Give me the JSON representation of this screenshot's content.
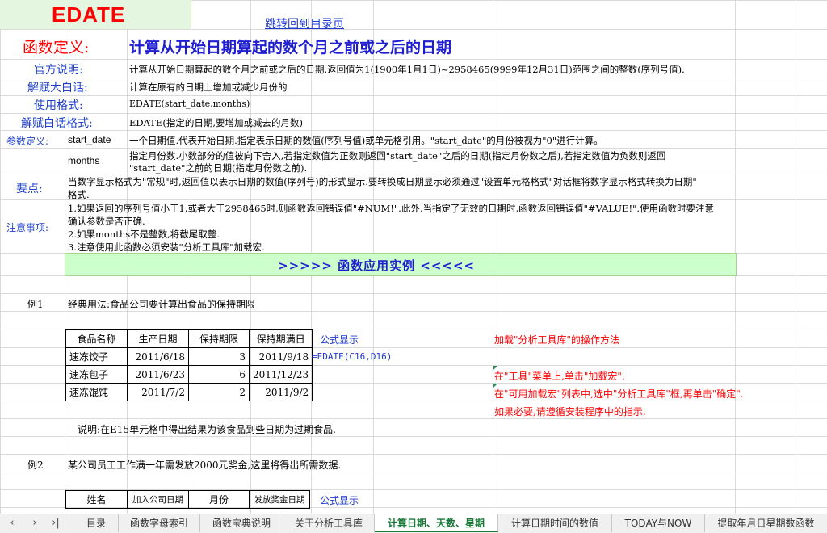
{
  "header": {
    "title": "EDATE",
    "back_link": "跳转回到目录页"
  },
  "definition": {
    "label": "函数定义:",
    "text": "计算从开始日期算起的数个月之前或之后的日期"
  },
  "rows": {
    "official_label": "官方说明:",
    "official_text": "计算从开始日期算起的数个月之前或之后的日期.返回值为1(1900年1月1日)~2958465(9999年12月31日)范围之间的整数(序列号值).",
    "plain_label": "解赋大白话:",
    "plain_text": "计算在原有的日期上增加或减少月份的",
    "usage_label": "使用格式:",
    "usage_text": "EDATE(start_date,months)",
    "plain_usage_label": "解赋白话格式:",
    "plain_usage_text": "EDATE(指定的日期,要增加或减去的月数)",
    "param_label": "参数定义:",
    "param1_name": "start_date",
    "param1_text": "一个日期值.代表开始日期.指定表示日期的数值(序列号值)或单元格引用。\"start_date\"的月份被视为\"0\"进行计算。",
    "param2_name": "months",
    "param2_text_1": "指定月份数.小数部分的值被向下舍入,若指定数值为正数则返回\"start_date\"之后的日期(指定月份数之后),若指定数值为负数则返回",
    "param2_text_2": "\"start_date\"之前的日期(指定月份数之前).",
    "key_label": "要点:",
    "key_text_1": "当数字显示格式为\"常规\"时,返回值以表示日期的数值(序列号)的形式显示.要转换成日期显示必须通过\"设置单元格格式\"对话框将数字显示格式转换为日期\"",
    "key_text_2": "格式.",
    "note_label": "注意事项:",
    "note_1a": "1.如果返回的序列号值小于1,或者大于2958465时,则函数返回错误值\"#NUM!\".此外,当指定了无效的日期时,函数返回错误值\"#VALUE!\".使用函数时要注意",
    "note_1b": "确认参数是否正确.",
    "note_2": "2.如果months不是整数,将截尾取整.",
    "note_3": "3.注意使用此函数必须安装\"分析工具库\"加载宏."
  },
  "band": {
    "text": ">>>>>  函数应用实例  <<<<<"
  },
  "example1": {
    "label": "例1",
    "desc": "经典用法:食品公司要计算出食品的保持期限",
    "headers": [
      "食品名称",
      "生产日期",
      "保持期限",
      "保持期满日"
    ],
    "rows": [
      [
        "速冻饺子",
        "2011/6/18",
        "3",
        "2011/9/18"
      ],
      [
        "速冻包子",
        "2011/6/23",
        "6",
        "2011/12/23"
      ],
      [
        "速冻馄饨",
        "2011/7/2",
        "2",
        "2011/9/2"
      ]
    ],
    "formula_label": "公式显示",
    "formula": "=EDATE(C16,D16)",
    "note": "说明:在E15单元格中得出结果为该食品到些日期为过期食品.",
    "addin_title": "加载\"分析工具库\"的操作方法",
    "addin_step1": "在\"工具\"菜单上,单击\"加载宏\".",
    "addin_step2": "在\"可用加载宏\"列表中,选中\"分析工具库\"框,再单击\"确定\".",
    "addin_step3": "如果必要,请遵循安装程序中的指示."
  },
  "example2": {
    "label": "例2",
    "desc": "某公司员工工作满一年需发放2000元奖金,这里将得出所需数据.",
    "headers": [
      "姓名",
      "加入公司日期",
      "月份",
      "发放奖金日期"
    ],
    "formula_label": "公式显示"
  },
  "tabs": {
    "items": [
      "目录",
      "函数字母索引",
      "函数宝典说明",
      "关于分析工具库",
      "计算日期、天数、星期",
      "计算日期时间的数值",
      "TODAY与NOW",
      "提取年月日星期数函数"
    ],
    "active_index": 4
  },
  "colors": {
    "title_red": "#ff0000",
    "label_blue": "#1f40c8",
    "band_green": "#ccffcc",
    "active_tab": "#1b7a3a"
  }
}
